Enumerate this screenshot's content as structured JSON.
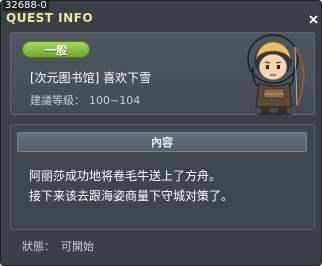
{
  "window": {
    "quest_id": "32688-0",
    "title": "QUEST INFO"
  },
  "header": {
    "category_label": "一般",
    "quest_name": "[次元图书馆] 喜欢下雪",
    "level_label": "建議等級：",
    "level_value": "100~104"
  },
  "content": {
    "header_label": "內容",
    "lines": [
      "阿丽莎成功地将卷毛牛送上了方舟。",
      "接下来该去跟海姿商量下守城对策了。"
    ]
  },
  "status": {
    "label": "狀態：",
    "value": "可開始"
  },
  "icons": {
    "close": "close-icon",
    "npc": "npc-portrait"
  },
  "colors": {
    "title": "#f2e6a0",
    "badge": "#8cc43f",
    "panel": "#4a525b",
    "window": "#3a4046"
  }
}
